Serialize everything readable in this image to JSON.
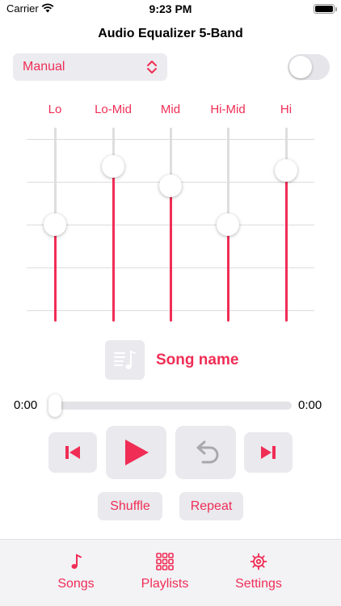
{
  "status_bar": {
    "carrier": "Carrier",
    "time": "9:23 PM"
  },
  "title": "Audio Equalizer 5-Band",
  "preset": {
    "value": "Manual"
  },
  "toggle": {
    "on": false
  },
  "accent_color": "#f02d55",
  "bands": [
    {
      "label": "Lo",
      "level": 0.5
    },
    {
      "label": "Lo-Mid",
      "level": 0.8
    },
    {
      "label": "Mid",
      "level": 0.7
    },
    {
      "label": "Hi-Mid",
      "level": 0.5
    },
    {
      "label": "Hi",
      "level": 0.78
    }
  ],
  "song": {
    "name": "Song name",
    "artwork_icon": "music-note-list-icon"
  },
  "playback": {
    "elapsed": "0:00",
    "remaining": "0:00",
    "progress": 0
  },
  "controls": {
    "previous_icon": "skip-back-icon",
    "play_icon": "play-icon",
    "restart_icon": "undo-arrow-icon",
    "next_icon": "skip-forward-icon",
    "shuffle_label": "Shuffle",
    "repeat_label": "Repeat"
  },
  "tabs": [
    {
      "label": "Songs",
      "icon": "music-note-icon"
    },
    {
      "label": "Playlists",
      "icon": "grid-icon"
    },
    {
      "label": "Settings",
      "icon": "gear-icon"
    }
  ]
}
